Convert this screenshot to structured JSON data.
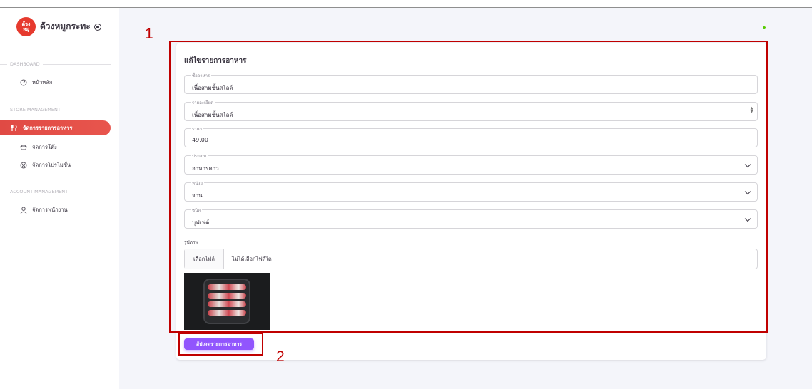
{
  "sidebar": {
    "brand": {
      "logo_text": "ด้วงหมูกระทะ",
      "name": "ด้วงหมูกระทะ",
      "logo_color": "#e63a2e"
    },
    "sections": [
      {
        "title": "DASHBOARD"
      },
      {
        "title": "STORE MANAGEMENT"
      },
      {
        "title": "ACCOUNT MANAGEMENT"
      }
    ],
    "items": [
      {
        "label": "หน้าหลัก",
        "icon": "dashboard-gauge-icon"
      },
      {
        "label": "จัดการรายการอาหาร",
        "icon": "fork-knife-icon",
        "active": true
      },
      {
        "label": "จัดการโต๊ะ",
        "icon": "table-icon"
      },
      {
        "label": "จัดการโปรโมชั่น",
        "icon": "promotion-badge-icon"
      },
      {
        "label": "จัดการพนักงาน",
        "icon": "user-icon"
      }
    ],
    "active_color": "#e04a44"
  },
  "form": {
    "title": "แก้ไขรายการอาหาร",
    "fields": {
      "name": {
        "label": "ชื่ออาหาร",
        "value": "เนื้อสามชั้นสไลด์"
      },
      "description": {
        "label": "รายละเอียด",
        "value": "เนื้อสามชั้นสไลด์"
      },
      "price": {
        "label": "ราคา",
        "value": "49.00"
      },
      "category": {
        "label": "ประเภท",
        "value": "อาหารคาว"
      },
      "unit": {
        "label": "หน่วย",
        "value": "จาน"
      },
      "type": {
        "label": "ชนิด",
        "value": "บุฟเฟต์"
      }
    },
    "image": {
      "label": "รูปภาพ",
      "choose_button": "เลือกไฟล์",
      "file_status": "ไม่ได้เลือกไฟล์ใด"
    },
    "submit_label": "อัปเดตรายการอาหาร",
    "submit_color": "#9155fd"
  },
  "annotations": {
    "box1_label": "1",
    "box2_label": "2",
    "color": "#c00000"
  },
  "status_dot_color": "#56ca00"
}
